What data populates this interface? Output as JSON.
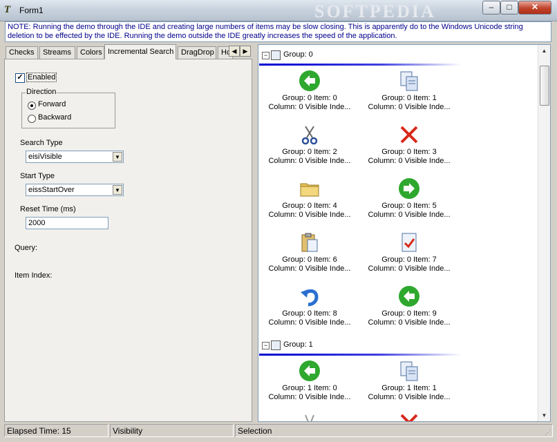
{
  "window": {
    "title": "Form1",
    "watermark": "SOFTPEDIA",
    "controls": {
      "minimize": "–",
      "maximize": "□",
      "close": "✕"
    }
  },
  "note": "NOTE:  Running the demo through the IDE and creating large numbers of items may be slow closing.  This is apparently do to the Windows Unicode string deletion to be effected by the IDE.  Running the demo outside the IDE greatly increases the speed of the application.",
  "tabs": [
    "Checks",
    "Streams",
    "Colors",
    "Incremental Search",
    "DragDrop",
    "Hc"
  ],
  "active_tab": "Incremental Search",
  "search": {
    "enabled_label": "Enabled",
    "enabled": true,
    "direction_label": "Direction",
    "forward_label": "Forward",
    "backward_label": "Backward",
    "direction": "Forward",
    "search_type_label": "Search Type",
    "search_type_value": "eisiVisible",
    "start_type_label": "Start Type",
    "start_type_value": "eissStartOver",
    "reset_time_label": "Reset Time (ms)",
    "reset_time_value": "2000",
    "query_label": "Query:",
    "item_index_label": "Item Index:"
  },
  "list": {
    "groups": [
      {
        "label": "Group: 0",
        "items": [
          {
            "t1": "Group: 0 Item: 0",
            "t2": "Column: 0 Visible Inde...",
            "icon": "back-arrow-icon"
          },
          {
            "t1": "Group: 0 Item: 1",
            "t2": "Column: 0 Visible Inde...",
            "icon": "copy-icon"
          },
          {
            "t1": "Group: 0 Item: 2",
            "t2": "Column: 0 Visible Inde...",
            "icon": "scissors-icon"
          },
          {
            "t1": "Group: 0 Item: 3",
            "t2": "Column: 0 Visible Inde...",
            "icon": "red-x-icon"
          },
          {
            "t1": "Group: 0 Item: 4",
            "t2": "Column: 0 Visible Inde...",
            "icon": "folder-icon"
          },
          {
            "t1": "Group: 0 Item: 5",
            "t2": "Column: 0 Visible Inde...",
            "icon": "forward-arrow-icon"
          },
          {
            "t1": "Group: 0 Item: 6",
            "t2": "Column: 0 Visible Inde...",
            "icon": "clipboard-icon"
          },
          {
            "t1": "Group: 0 Item: 7",
            "t2": "Column: 0 Visible Inde...",
            "icon": "checked-document-icon"
          },
          {
            "t1": "Group: 0 Item: 8",
            "t2": "Column: 0 Visible Inde...",
            "icon": "undo-icon"
          },
          {
            "t1": "Group: 0 Item: 9",
            "t2": "Column: 0 Visible Inde...",
            "icon": "back-arrow-icon"
          }
        ]
      },
      {
        "label": "Group: 1",
        "items": [
          {
            "t1": "Group: 1 Item: 0",
            "t2": "Column: 0 Visible Inde...",
            "icon": "back-arrow-icon"
          },
          {
            "t1": "Group: 1 Item: 1",
            "t2": "Column: 0 Visible Inde...",
            "icon": "copy-icon"
          }
        ]
      }
    ]
  },
  "status": {
    "elapsed": "Elapsed Time: 15",
    "visibility": "Visibility",
    "selection": "Selection"
  }
}
